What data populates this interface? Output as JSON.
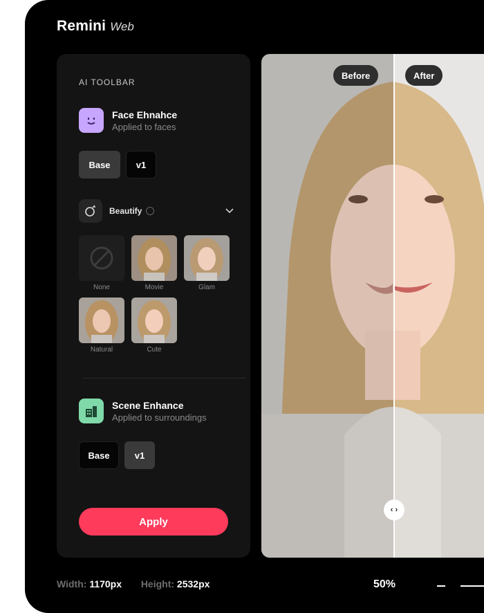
{
  "app": {
    "name": "Remini",
    "suffix": "Web"
  },
  "toolbar": {
    "title": "AI TOOLBAR",
    "face": {
      "title": "Face Ehnahce",
      "subtitle": "Applied to faces",
      "versions": [
        "Base",
        "v1"
      ],
      "selected": "Base"
    },
    "beautify": {
      "label": "Beautify",
      "options": [
        "None",
        "Movie",
        "Glam",
        "Natural",
        "Cute"
      ]
    },
    "scene": {
      "title": "Scene Enhance",
      "subtitle": "Applied to surroundings",
      "versions": [
        "Base",
        "v1"
      ],
      "selected": "Base"
    },
    "apply_label": "Apply"
  },
  "preview": {
    "before_label": "Before",
    "after_label": "After",
    "handle_label": "‹ ›",
    "split_fraction": 0.56
  },
  "footer": {
    "width_label": "Width:",
    "width_value": "1170px",
    "height_label": "Height:",
    "height_value": "2532px",
    "zoom": "50%"
  },
  "colors": {
    "accent": "#ff3b5c",
    "face_icon": "#c7a6ff",
    "scene_icon": "#7fd9a8"
  },
  "icons": {
    "face": "smile-face-icon",
    "beautify": "beautify-drop-icon",
    "scene": "scene-building-icon",
    "none": "block-icon",
    "expand": "chevron-down-icon",
    "split": "split-handle-icon"
  }
}
